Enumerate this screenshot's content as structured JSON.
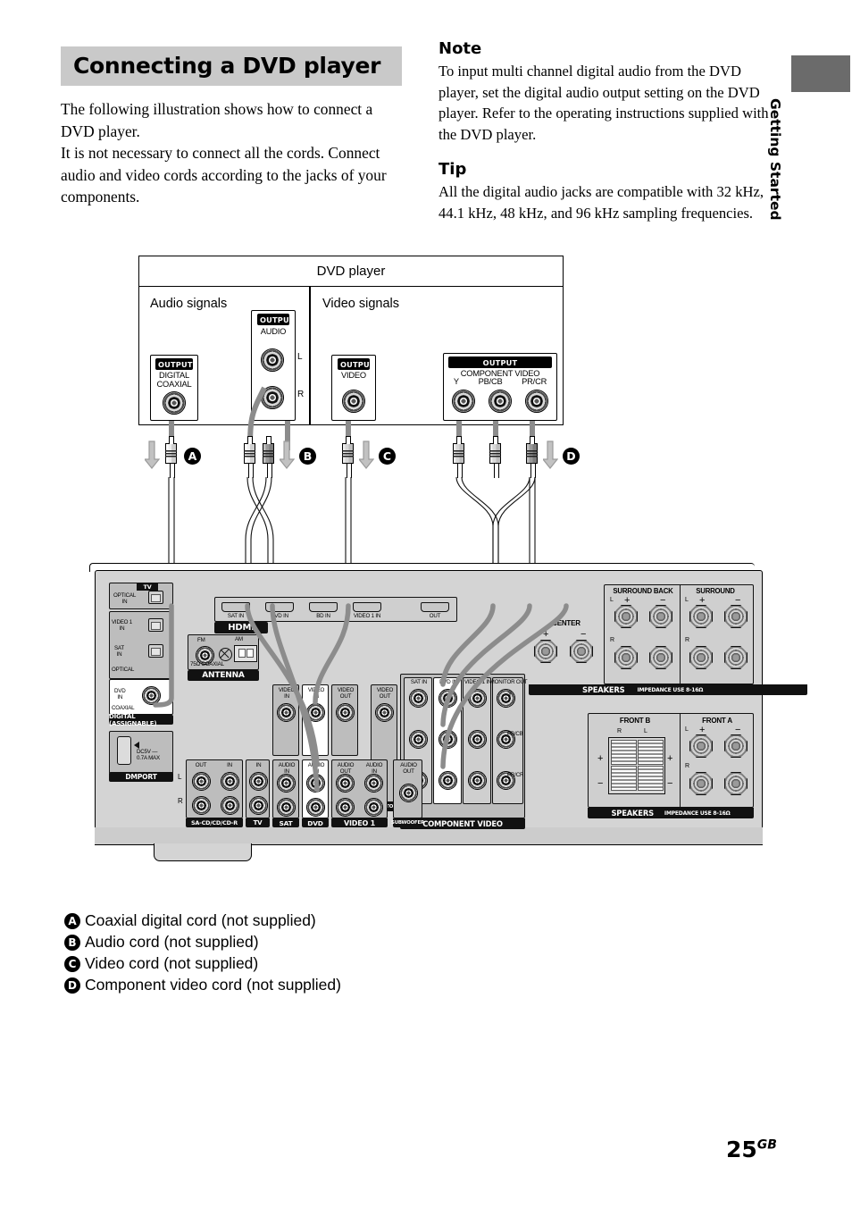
{
  "section": {
    "title": "Connecting a DVD player",
    "paragraphs": [
      "The following illustration shows how to connect a DVD player.",
      "It is not necessary to connect all the cords. Connect audio and video cords according to the jacks of your components."
    ]
  },
  "note": {
    "heading": "Note",
    "text": "To input multi channel digital audio from the DVD player, set the digital audio output setting on the DVD player. Refer to the operating instructions supplied with the DVD player."
  },
  "tip": {
    "heading": "Tip",
    "text": "All the digital audio jacks are compatible with 32 kHz, 44.1 kHz, 48 kHz, and 96 kHz sampling frequencies."
  },
  "side_tab": {
    "label": "Getting Started"
  },
  "page_number": {
    "number": "25",
    "suffix": "GB"
  },
  "figure": {
    "dvd_player": {
      "title": "DVD player",
      "audio_section_label": "Audio signals",
      "video_section_label": "Video signals",
      "jacks": {
        "digital_coaxial": {
          "tag": "OUTPUT",
          "line1": "DIGITAL",
          "line2": "COAXIAL"
        },
        "audio": {
          "tag": "OUTPUT",
          "label": "AUDIO",
          "left": "L",
          "right": "R"
        },
        "video": {
          "tag": "OUTPUT",
          "label": "VIDEO"
        },
        "component": {
          "tag": "OUTPUT",
          "label1": "COMPONENT",
          "label2": "VIDEO",
          "y": "Y",
          "pb": "PB/CB",
          "pr": "PR/CR"
        }
      }
    },
    "cord_markers": [
      "A",
      "B",
      "C",
      "D"
    ],
    "receiver": {
      "optical_block": {
        "tv_tag": "TV",
        "tv_optical_in": [
          "OPTICAL",
          "IN"
        ],
        "video1_in": [
          "VIDEO 1",
          "IN"
        ],
        "sat_in": [
          "SAT",
          "IN"
        ],
        "optical_label": "OPTICAL",
        "dvd_in": [
          "DVD",
          "IN"
        ],
        "coaxial_label": "COAXIAL",
        "bar": "DIGITAL (ASSIGNABLE)"
      },
      "dmport": {
        "label": "DMPORT",
        "power": [
          "DC5V",
          "0.7A MAX"
        ]
      },
      "antenna": {
        "bar": "ANTENNA",
        "fm": "FM",
        "fm_sub": "75Ω COAXIAL",
        "am": "AM"
      },
      "hdmi": {
        "bar": "HDMI",
        "ports": [
          "SAT IN",
          "DVD IN",
          "BD IN",
          "VIDEO 1 IN",
          "OUT"
        ]
      },
      "component_video": {
        "bar": "COMPONENT VIDEO",
        "columns": [
          "SAT IN",
          "DVD IN",
          "VIDEO 1 IN",
          "MONITOR OUT"
        ],
        "rows": [
          "Y",
          "PB/CB",
          "PR/CR"
        ]
      },
      "monitor": {
        "label": [
          "VIDEO",
          "OUT"
        ],
        "bar": "MONITOR"
      },
      "video_rows": [
        {
          "bar": "SA-CD/CD/CD-R",
          "video": [],
          "audio": [
            "OUT",
            "IN"
          ],
          "lr": [
            "L",
            "R"
          ]
        },
        {
          "bar": "TV",
          "video": [],
          "audio": [
            "IN"
          ]
        },
        {
          "bar": "SAT",
          "video": [
            "VIDEO IN"
          ],
          "audio": [
            "AUDIO IN"
          ]
        },
        {
          "bar": "DVD",
          "video": [
            "VIDEO IN"
          ],
          "audio": [
            "AUDIO IN"
          ]
        },
        {
          "bar": "VIDEO 1",
          "video": [
            "VIDEO OUT",
            "VIDEO IN"
          ],
          "audio": [
            "AUDIO OUT",
            "AUDIO IN"
          ]
        },
        {
          "bar": "SUBWOOFER",
          "video": [],
          "audio": [
            "AUDIO OUT"
          ]
        }
      ],
      "speakers_upper": {
        "surround_back": "SURROUND BACK",
        "surround": "SURROUND",
        "center": "CENTER",
        "bar": "SPEAKERS",
        "impedance": "IMPEDANCE USE 8-16Ω",
        "plus": "+",
        "minus": "−",
        "l": "L",
        "r": "R"
      },
      "speakers_lower": {
        "front_b": "FRONT B",
        "front_a": "FRONT A",
        "bar": "SPEAKERS",
        "impedance": "IMPEDANCE USE 8-16Ω",
        "plus": "+",
        "minus": "−",
        "l": "L",
        "r": "R"
      }
    }
  },
  "legend": [
    {
      "marker": "A",
      "text": "Coaxial digital cord (not supplied)"
    },
    {
      "marker": "B",
      "text": "Audio cord (not supplied)"
    },
    {
      "marker": "C",
      "text": "Video cord (not supplied)"
    },
    {
      "marker": "D",
      "text": "Component video cord (not supplied)"
    }
  ],
  "colors": {
    "heading_bg": "#c9c9c9",
    "tab": "#6b6b6b",
    "panel": "#d4d4d4",
    "ink": "#000000"
  }
}
